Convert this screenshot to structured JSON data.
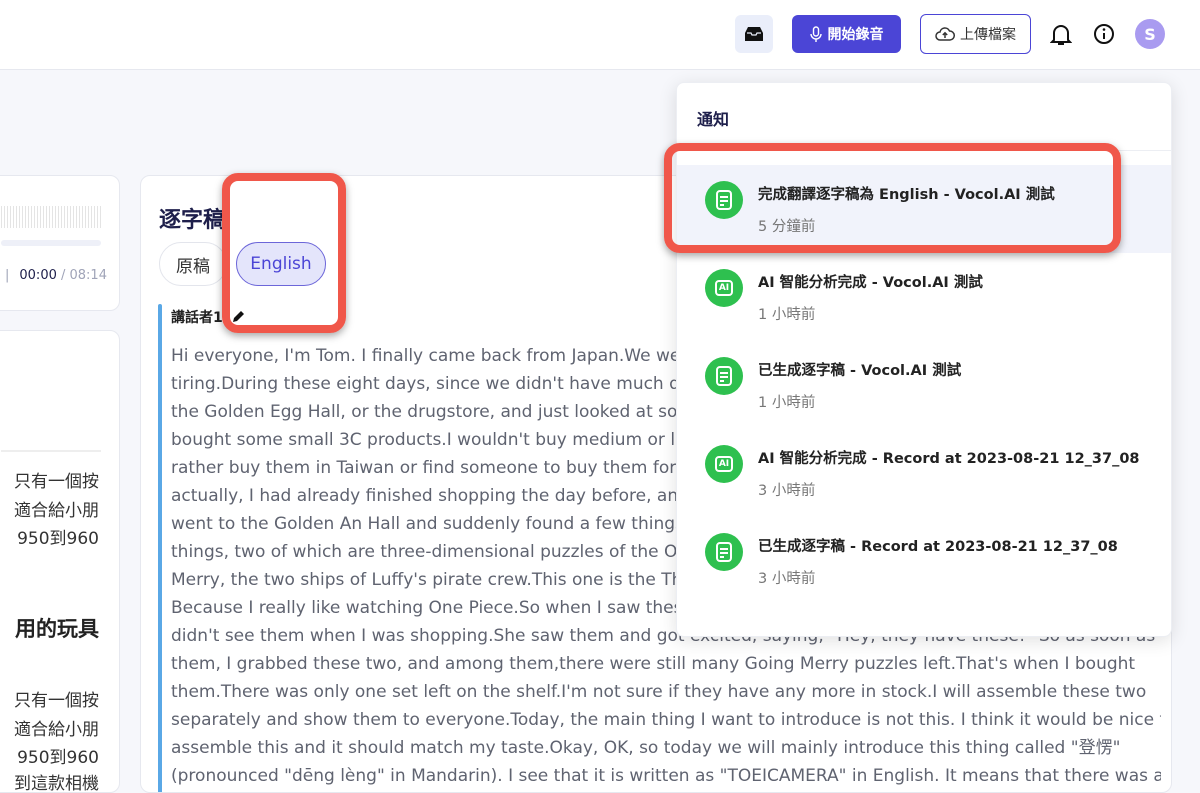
{
  "header": {
    "record_label": "開始錄音",
    "upload_label": "上傳檔案",
    "avatar_initial": "S"
  },
  "player": {
    "current": "00:00",
    "total": "/ 08:14",
    "sep": "|"
  },
  "summary": {
    "lines": [
      "只有一個按",
      "適合給小朋",
      "950到960"
    ],
    "heading": "用的玩具",
    "lines2": [
      "只有一個按",
      "適合給小朋",
      "950到960",
      "到這款相機"
    ]
  },
  "transcript": {
    "title": "逐字稿",
    "tabs": [
      {
        "label": "原稿"
      },
      {
        "label": "English"
      }
    ],
    "speaker": "講話者1",
    "lines": [
      "Hi everyone, I'm Tom. I finally came back from Japan.We went f",
      "tiring.During these eight days, since we didn't have much desir",
      "the Golden Egg Hall, or the drugstore, and just looked at some",
      "bought some small 3C products.I wouldn't buy medium or larg",
      "rather buy them in Taiwan or find someone to buy them for m",
      "actually, I had already finished shopping the day before, and I c",
      "went to the Golden An Hall and suddenly found a few things th",
      "things, two of which are three-dimensional puzzles of the One",
      "Merry, the two ships of Luffy's pirate crew.This one is the Thous",
      "Because I really like watching One Piece.So when I saw these, I",
      "didn't see them when I was shopping.She saw them and got excited, saying, \"Hey, they have these!\" So as soon as I saw",
      "them, I grabbed these two, and among them,there were still many Going Merry puzzles left.That's when I bought",
      "them.There was only one set left on the shelf.I'm not sure if they have any more in stock.I will assemble these two",
      "separately and show them to everyone.Today, the main thing I want to introduce is not this. I think it would be nice to",
      "assemble this and it should match my taste.Okay, OK, so today we will mainly introduce this thing called \"登愣\"",
      "(pronounced \"dēng lèng\" in Mandarin). I see that it is written as \"TOEICAMERA\" in English. It means that there was a"
    ]
  },
  "notifications": {
    "title": "通知",
    "items": [
      {
        "icon": "document",
        "title": "完成翻譯逐字稿為 English - Vocol.AI 測試",
        "time": "5 分鐘前"
      },
      {
        "icon": "ai",
        "title": "AI 智能分析完成 - Vocol.AI 測試",
        "time": "1 小時前"
      },
      {
        "icon": "document",
        "title": "已生成逐字稿 - Vocol.AI 測試",
        "time": "1 小時前"
      },
      {
        "icon": "ai",
        "title": "AI 智能分析完成 - Record at 2023-08-21 12_37_08",
        "time": "3 小時前"
      },
      {
        "icon": "document",
        "title": "已生成逐字稿 - Record at 2023-08-21 12_37_08",
        "time": "3 小時前"
      }
    ],
    "ai_icon_text": "AI"
  },
  "colors": {
    "primary": "#4b45d6",
    "success": "#2ec04f",
    "highlight": "#f0574a"
  }
}
